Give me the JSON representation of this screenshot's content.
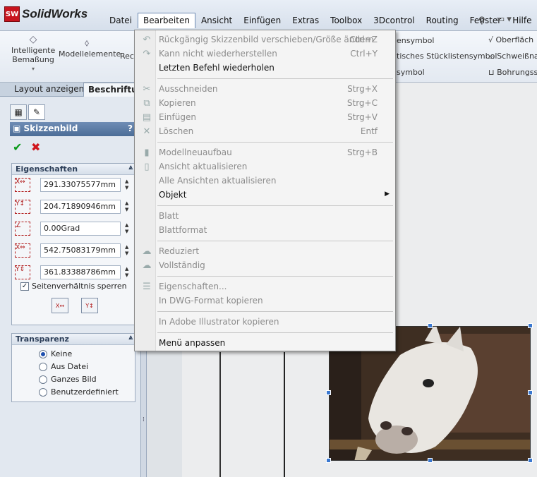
{
  "app": {
    "logo_text": "SolidWorks",
    "logo_badge": "SW"
  },
  "mainmenu": [
    "Datei",
    "Bearbeiten",
    "Ansicht",
    "Einfügen",
    "Extras",
    "Toolbox",
    "3Dcontrol",
    "Routing",
    "Fenster",
    "Hilfe"
  ],
  "ribbon": {
    "btn1_line1": "Intelligente",
    "btn1_line2": "Bemaßung",
    "btn2": "Modellelemente",
    "btn3": "Rec",
    "right1a": "ensymbol",
    "right1b": "Oberfläch",
    "right2a": "tisches Stücklistensymbol",
    "right2b": "Schweißna",
    "right3a": "symbol",
    "right3b": "Bohrungssy"
  },
  "cm_tabs": {
    "tab1": "Layout anzeigen",
    "tab2": "Beschriftu"
  },
  "property_manager": {
    "title": "Skizzenbild",
    "help": "?",
    "group1": {
      "title": "Eigenschaften",
      "x_pos": "291.33075577mm",
      "y_pos": "204.71890946mm",
      "angle": "0.00Grad",
      "width": "542.75083179mm",
      "height": "361.83388786mm",
      "lock_aspect": "Seitenverhältnis sperren"
    },
    "group2": {
      "title": "Transparenz",
      "options": [
        "Keine",
        "Aus Datei",
        "Ganzes Bild",
        "Benutzerdefiniert"
      ],
      "selected": 0
    }
  },
  "edit_menu": {
    "items": [
      {
        "label": "Rückgängig Skizzenbild verschieben/Größe ändern",
        "shortcut": "Ctrl+Z"
      },
      {
        "label": "Kann nicht wiederherstellen",
        "shortcut": "Ctrl+Y"
      },
      {
        "label": "Letzten Befehl wiederholen",
        "shortcut": ""
      },
      {
        "label": "Ausschneiden",
        "shortcut": "Strg+X"
      },
      {
        "label": "Kopieren",
        "shortcut": "Strg+C"
      },
      {
        "label": "Einfügen",
        "shortcut": "Strg+V"
      },
      {
        "label": "Löschen",
        "shortcut": "Entf"
      },
      {
        "label": "Modellneuaufbau",
        "shortcut": "Strg+B"
      },
      {
        "label": "Ansicht aktualisieren",
        "shortcut": ""
      },
      {
        "label": "Alle Ansichten aktualisieren",
        "shortcut": ""
      },
      {
        "label": "Objekt",
        "shortcut": ""
      },
      {
        "label": "Blatt",
        "shortcut": ""
      },
      {
        "label": "Blattformat",
        "shortcut": ""
      },
      {
        "label": "Reduziert",
        "shortcut": ""
      },
      {
        "label": "Vollständig",
        "shortcut": ""
      },
      {
        "label": "Eigenschaften...",
        "shortcut": ""
      },
      {
        "label": "In DWG-Format kopieren",
        "shortcut": ""
      },
      {
        "label": "In Adobe Illustrator kopieren",
        "shortcut": ""
      },
      {
        "label": "Menü anpassen",
        "shortcut": ""
      }
    ]
  }
}
